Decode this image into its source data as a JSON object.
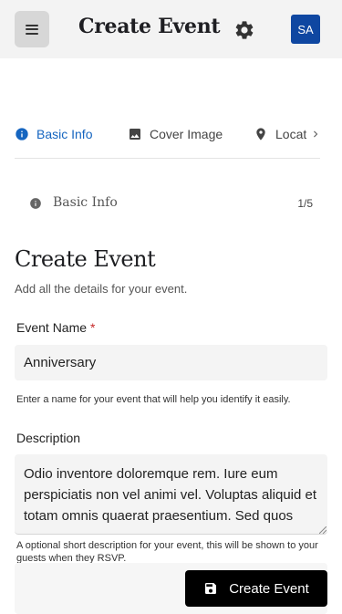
{
  "header": {
    "title": "Create Event",
    "avatar_initials": "SA",
    "menu_icon": "menu-icon",
    "settings_icon": "gear-icon",
    "avatar_color": "#0f47a1"
  },
  "tabs": [
    {
      "label": "Basic Info",
      "icon": "info-icon",
      "active": true
    },
    {
      "label": "Cover Image",
      "icon": "image-icon",
      "active": false
    },
    {
      "label": "Locatio",
      "icon": "location-pin-icon",
      "active": false
    }
  ],
  "step": {
    "label": "Basic Info",
    "counter": "1/5",
    "icon": "info-icon"
  },
  "section": {
    "title": "Create Event",
    "subtitle": "Add all the details for your event."
  },
  "event_name": {
    "label": "Event Name",
    "required_mark": "*",
    "value": "Anniversary",
    "help": "Enter a name for your event that will help you identify it easily."
  },
  "description": {
    "label": "Description",
    "value": "Odio inventore doloremque rem. Iure eum perspiciatis non vel animi vel. Voluptas aliquid et totam omnis quaerat praesentium. Sed quos",
    "help": "A optional short description for your event, this will be shown to your guests when they RSVP."
  },
  "submit": {
    "label": "Create Event",
    "icon": "save-icon"
  },
  "colors": {
    "accent": "#1565c0",
    "required": "#c62828",
    "button": "#000000"
  }
}
